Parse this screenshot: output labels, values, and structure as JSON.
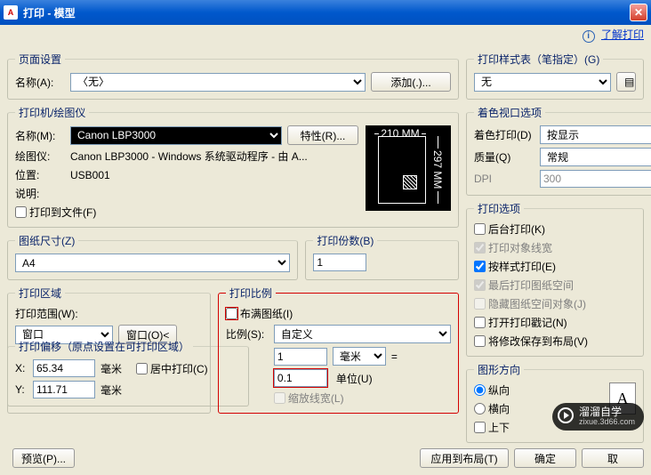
{
  "window": {
    "title": "打印 - 模型"
  },
  "help": {
    "link": "了解打印"
  },
  "page_setup": {
    "legend": "页面设置",
    "name_label": "名称(A):",
    "name_value": "〈无〉",
    "add_button": "添加(.)..."
  },
  "printer": {
    "legend": "打印机/绘图仪",
    "name_label": "名称(M):",
    "name_value": "Canon LBP3000",
    "props_button": "特性(R)...",
    "plotter_label": "绘图仪:",
    "plotter_value": "Canon LBP3000 - Windows 系统驱动程序 - 由 A...",
    "loc_label": "位置:",
    "loc_value": "USB001",
    "desc_label": "说明:",
    "desc_value": "",
    "to_file": "打印到文件(F)",
    "preview_w": "210 MM",
    "preview_h": "297 MM"
  },
  "paper_size": {
    "legend": "图纸尺寸(Z)",
    "value": "A4"
  },
  "copies": {
    "legend": "打印份数(B)",
    "value": "1"
  },
  "area": {
    "legend": "打印区域",
    "range_label": "打印范围(W):",
    "range_value": "窗口",
    "window_btn": "窗口(O)<"
  },
  "scale": {
    "legend": "打印比例",
    "fit": "布满图纸(I)",
    "ratio_label": "比例(S):",
    "ratio_value": "自定义",
    "num": "1",
    "num_unit": "毫米",
    "den": "0.1",
    "den_unit": "单位(U)",
    "lw": "缩放线宽(L)",
    "eq": "="
  },
  "offset": {
    "legend": "打印偏移（原点设置在可打印区域）",
    "x_label": "X:",
    "x_value": "65.34",
    "x_unit": "毫米",
    "y_label": "Y:",
    "y_value": "111.71",
    "y_unit": "毫米",
    "center": "居中打印(C)"
  },
  "style": {
    "legend": "打印样式表（笔指定）(G)",
    "value": "无"
  },
  "viewport": {
    "legend": "着色视口选项",
    "shade_label": "着色打印(D)",
    "shade_value": "按显示",
    "quality_label": "质量(Q)",
    "quality_value": "常规",
    "dpi_label": "DPI",
    "dpi_value": "300"
  },
  "options": {
    "legend": "打印选项",
    "bg": "后台打印(K)",
    "lw": "打印对象线宽",
    "style": "按样式打印(E)",
    "paperspace": "最后打印图纸空间",
    "hide": "隐藏图纸空间对象(J)",
    "stamp": "打开打印戳记(N)",
    "save": "将修改保存到布局(V)"
  },
  "orient": {
    "legend": "图形方向",
    "portrait": "纵向",
    "landscape": "横向",
    "upside": "上下"
  },
  "footer": {
    "preview": "预览(P)...",
    "apply": "应用到布局(T)",
    "ok": "确定",
    "cancel": "取"
  },
  "watermark": {
    "main": "溜溜自学",
    "sub": "zixue.3d66.com"
  }
}
